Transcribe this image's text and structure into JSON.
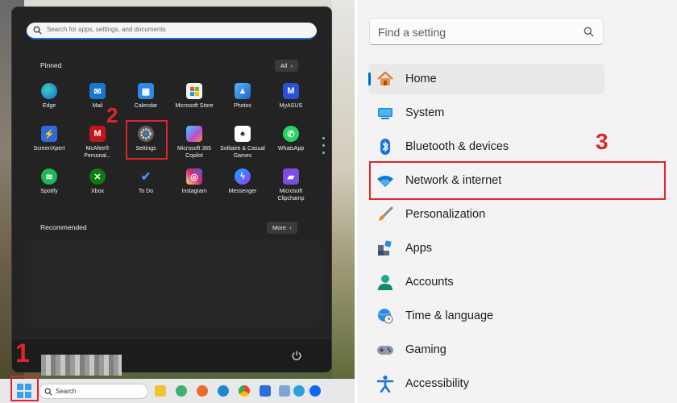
{
  "start_menu": {
    "search_placeholder": "Search for apps, settings, and documents",
    "pinned_label": "Pinned",
    "all_button": "All",
    "recommended_label": "Recommended",
    "more_button": "More",
    "pinned_apps": [
      {
        "label": "Edge",
        "icon": "edge-icon",
        "color": "#1e88d8"
      },
      {
        "label": "Mail",
        "icon": "mail-icon",
        "color": "#1677d2"
      },
      {
        "label": "Calendar",
        "icon": "calendar-icon",
        "color": "#2a8ae6"
      },
      {
        "label": "Microsoft Store",
        "icon": "store-icon",
        "color": "#f2f2f2"
      },
      {
        "label": "Photos",
        "icon": "photos-icon",
        "color": "#3d8fe0"
      },
      {
        "label": "MyASUS",
        "icon": "myasus-icon",
        "color": "#2b4fd6"
      },
      {
        "label": "ScreenXpert",
        "icon": "screenxpert-icon",
        "color": "#2f6bd8"
      },
      {
        "label": "McAfee® Personal...",
        "icon": "mcafee-icon",
        "color": "#c0161e"
      },
      {
        "label": "Settings",
        "icon": "settings-gear-icon",
        "color": "#6e6e6e"
      },
      {
        "label": "Microsoft 365 Copilot",
        "icon": "m365-copilot-icon",
        "color": "#b84fd1"
      },
      {
        "label": "Solitaire & Casual Games",
        "icon": "solitaire-icon",
        "color": "#1f5c2a"
      },
      {
        "label": "WhatsApp",
        "icon": "whatsapp-icon",
        "color": "#25d366"
      },
      {
        "label": "Spotify",
        "icon": "spotify-icon",
        "color": "#1db954"
      },
      {
        "label": "Xbox",
        "icon": "xbox-icon",
        "color": "#107c10"
      },
      {
        "label": "To Do",
        "icon": "todo-icon",
        "color": "#2564cf"
      },
      {
        "label": "Instagram",
        "icon": "instagram-icon",
        "color": "#d62976"
      },
      {
        "label": "Messenger",
        "icon": "messenger-icon",
        "color": "#2f7bf6"
      },
      {
        "label": "Microsoft Clipchamp",
        "icon": "clipchamp-icon",
        "color": "#7b4ee0"
      }
    ]
  },
  "taskbar": {
    "search_label": "Search"
  },
  "steps": {
    "one": "1",
    "two": "2",
    "three": "3"
  },
  "settings": {
    "find_placeholder": "Find a setting",
    "nav": [
      {
        "label": "Home",
        "icon": "home-icon",
        "active": true
      },
      {
        "label": "System",
        "icon": "system-monitor-icon"
      },
      {
        "label": "Bluetooth & devices",
        "icon": "bluetooth-icon"
      },
      {
        "label": "Network & internet",
        "icon": "wifi-icon"
      },
      {
        "label": "Personalization",
        "icon": "brush-icon"
      },
      {
        "label": "Apps",
        "icon": "apps-icon"
      },
      {
        "label": "Accounts",
        "icon": "accounts-icon"
      },
      {
        "label": "Time & language",
        "icon": "globe-clock-icon"
      },
      {
        "label": "Gaming",
        "icon": "gamepad-icon"
      },
      {
        "label": "Accessibility",
        "icon": "accessibility-icon"
      }
    ]
  },
  "colors": {
    "accent": "#0067c0",
    "highlight_red": "#e0242b"
  }
}
